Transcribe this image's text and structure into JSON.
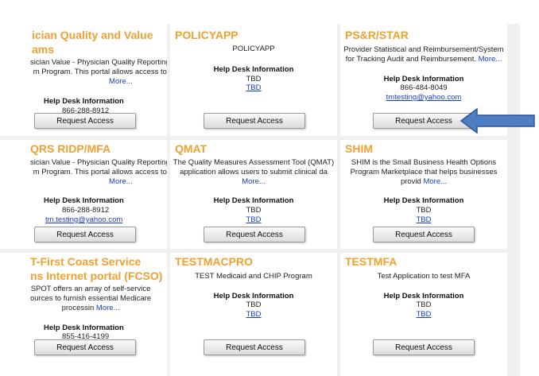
{
  "cards": [
    {
      "title_line1": "ician Quality and Value",
      "title_line2": "ams",
      "desc_lines": [
        "sician Value - Physician Quality Reporting",
        "m Program. This portal allows access to"
      ],
      "more": "More...",
      "hd_title": "Help Desk Information",
      "hd_phone": "866-288-8912",
      "hd_link": "",
      "button": "Request Access"
    },
    {
      "title_line1": "POLICYAPP",
      "title_line2": "",
      "desc_lines": [
        "POLICYAPP"
      ],
      "more": "",
      "hd_title": "Help Desk Information",
      "hd_phone": "TBD",
      "hd_link": "TBD",
      "button": "Request Access"
    },
    {
      "title_line1": "PS&R/STAR",
      "title_line2": "",
      "desc_lines": [
        "Provider Statistical and Reimbursement/System",
        "for Tracking Audit and Reimbursement."
      ],
      "more": "More...",
      "hd_title": "Help Desk Information",
      "hd_phone": "866-484-8049",
      "hd_link": "tmtesting@yahoo.com",
      "button": "Request Access"
    },
    {
      "title_line1": "QRS RIDP/MFA",
      "title_line2": "",
      "desc_lines": [
        "sician Value - Physician Quality Reporting",
        "m Program. This portal allows access to"
      ],
      "more": "More...",
      "hd_title": "Help Desk Information",
      "hd_phone": "866-288-8912",
      "hd_link": "tm.testing@yahoo.com",
      "button": "Request Access"
    },
    {
      "title_line1": "QMAT",
      "title_line2": "",
      "desc_lines": [
        "The Quality Measures Assessment Tool (QMAT)",
        "application allows users to submit clinical da"
      ],
      "more": "More...",
      "hd_title": "Help Desk Information",
      "hd_phone": "TBD",
      "hd_link": "TBD",
      "button": "Request Access"
    },
    {
      "title_line1": "SHIM",
      "title_line2": "",
      "desc_lines": [
        "SHIM is the Small Business Health Options",
        "Program Marketplace that helps businesses",
        "provid"
      ],
      "more": "More...",
      "hd_title": "Help Desk Information",
      "hd_phone": "TBD",
      "hd_link": "TBD",
      "button": "Request Access"
    },
    {
      "title_line1": "T-First Coast Service",
      "title_line2": "ns Internet portal (FCSO)",
      "desc_lines": [
        "SPOT offers an array of self-service",
        "ources to furnish essential Medicare",
        "processin"
      ],
      "more": "More...",
      "hd_title": "Help Desk Information",
      "hd_phone": "855-416-4199",
      "hd_link": "",
      "button": "Request Access"
    },
    {
      "title_line1": "TESTMACPRO",
      "title_line2": "",
      "desc_lines": [
        "TEST Medicaid and CHIP Program"
      ],
      "more": "",
      "hd_title": "Help Desk Information",
      "hd_phone": "TBD",
      "hd_link": "TBD",
      "button": "Request Access"
    },
    {
      "title_line1": "TESTMFA",
      "title_line2": "",
      "desc_lines": [
        "Test Application to test MFA"
      ],
      "more": "",
      "hd_title": "Help Desk Information",
      "hd_phone": "TBD",
      "hd_link": "TBD",
      "button": "Request Access"
    }
  ],
  "annotation": {
    "arrow_color": "#4f7fc3",
    "arrow_icon": "arrow-left-icon"
  },
  "colors": {
    "title": "#f0a030",
    "link": "#1a3fbf",
    "gutter": "#f0f0f0"
  }
}
